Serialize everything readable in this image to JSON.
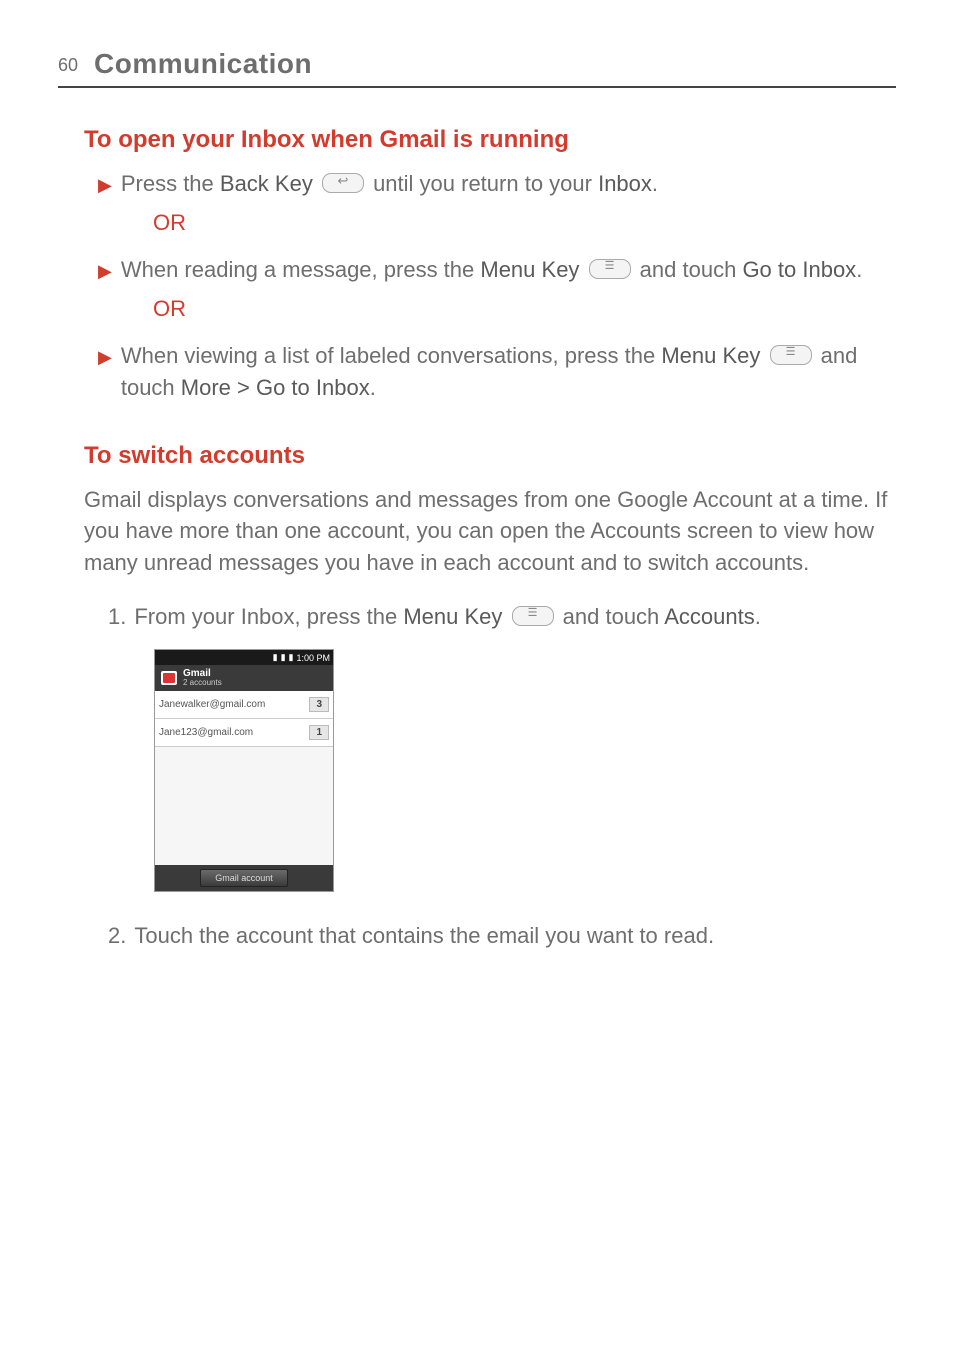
{
  "page": {
    "number": "60",
    "chapter": "Communication"
  },
  "section1": {
    "heading": "To open your Inbox when Gmail is running",
    "b1_a": "Press the ",
    "b1_b": "Back Key",
    "b1_c": " until you return to your ",
    "b1_d": "Inbox",
    "b1_e": ".",
    "or": "OR",
    "b2_a": "When reading a message, press the ",
    "b2_b": "Menu Key",
    "b2_c": " and touch ",
    "b2_d": "Go to Inbox",
    "b2_e": ".",
    "b3_a": "When viewing a list of labeled conversations, press the ",
    "b3_b": "Menu Key",
    "b3_c": " and touch ",
    "b3_d": "More > Go to Inbox",
    "b3_e": "."
  },
  "section2": {
    "heading": "To switch accounts",
    "para": "Gmail displays conversations and messages from one Google Account at a time. If you have more than one account, you can open the Accounts screen to view how many unread messages you have in each account and to switch accounts.",
    "s1_n": "1.",
    "s1_a": "From your Inbox, press the ",
    "s1_b": "Menu Key",
    "s1_c": " and touch ",
    "s1_d": "Accounts",
    "s1_e": ".",
    "s2_n": "2.",
    "s2_a": "Touch the account that contains the email you want to read."
  },
  "phone": {
    "time": "1:00 PM",
    "app": "Gmail",
    "sub": "2 accounts",
    "acct1": {
      "email": "Janewalker@gmail.com",
      "badge": "3"
    },
    "acct2": {
      "email": "Jane123@gmail.com",
      "badge": "1"
    },
    "button": "Gmail account"
  }
}
